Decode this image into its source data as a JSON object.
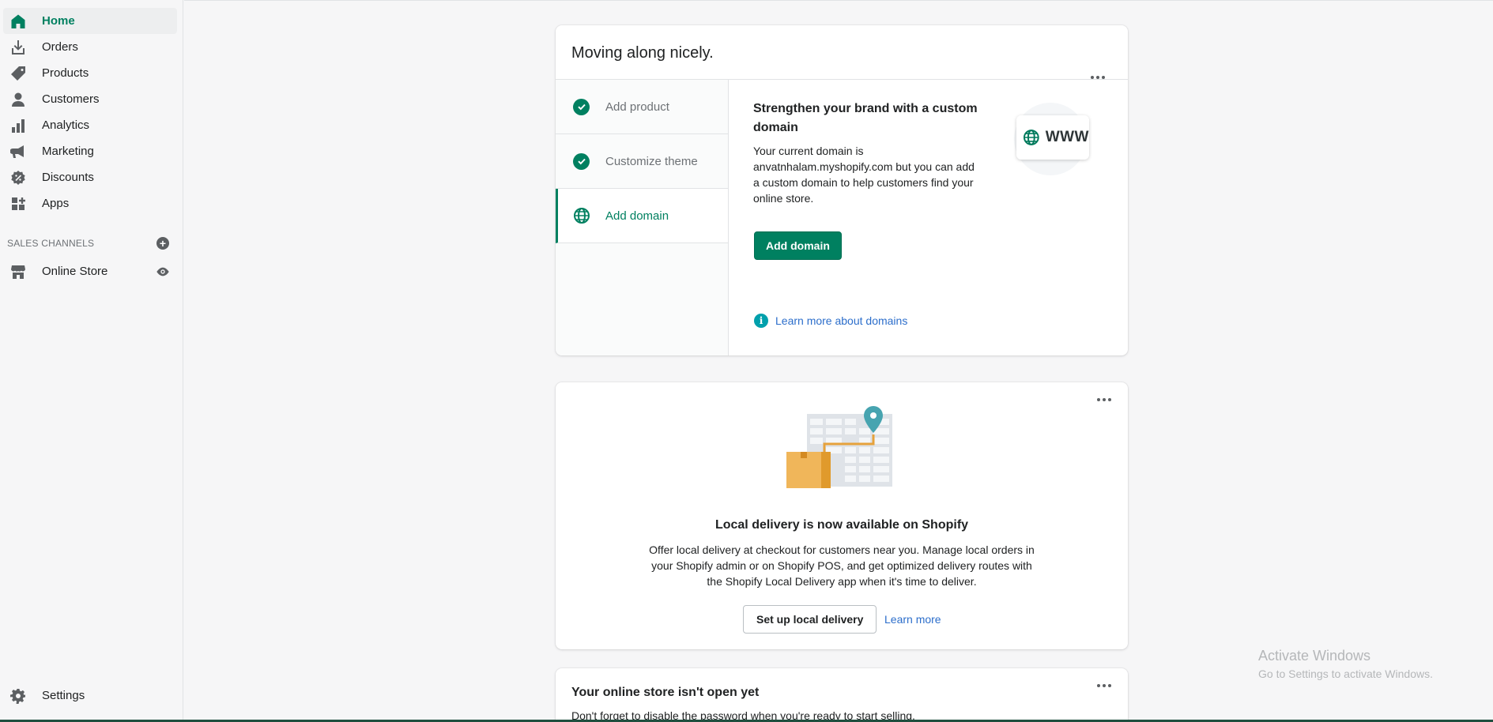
{
  "sidebar": {
    "items": [
      {
        "label": "Home",
        "icon": "home-icon"
      },
      {
        "label": "Orders",
        "icon": "orders-icon"
      },
      {
        "label": "Products",
        "icon": "tag-icon"
      },
      {
        "label": "Customers",
        "icon": "person-icon"
      },
      {
        "label": "Analytics",
        "icon": "bar-chart-icon"
      },
      {
        "label": "Marketing",
        "icon": "megaphone-icon"
      },
      {
        "label": "Discounts",
        "icon": "discount-icon"
      },
      {
        "label": "Apps",
        "icon": "apps-icon"
      }
    ],
    "sales_channels_label": "SALES CHANNELS",
    "online_store_label": "Online Store",
    "settings_label": "Settings"
  },
  "setup_card": {
    "title": "Moving along nicely.",
    "steps": [
      {
        "label": "Add product",
        "status": "complete"
      },
      {
        "label": "Customize theme",
        "status": "complete"
      },
      {
        "label": "Add domain",
        "status": "active"
      }
    ],
    "content_title": "Strengthen your brand with a custom domain",
    "content_body": "Your current domain is anvatnhalam.myshopify.com but you can add a custom domain to help customers find your online store.",
    "button_label": "Add domain",
    "learn_link": "Learn more about domains",
    "badge_text": "WWW"
  },
  "delivery_card": {
    "title": "Local delivery is now available on Shopify",
    "body": "Offer local delivery at checkout for customers near you. Manage local orders in your Shopify admin or on Shopify POS, and get optimized delivery routes with the Shopify Local Delivery app when it's time to deliver.",
    "button_label": "Set up local delivery",
    "learn_link": "Learn more"
  },
  "store_card": {
    "title": "Your online store isn't open yet",
    "body": "Don't forget to disable the password when you're ready to start selling."
  },
  "watermark": {
    "line1": "Activate Windows",
    "line2": "Go to Settings to activate Windows."
  },
  "colors": {
    "accent": "#008060",
    "link": "#2c6ecb"
  }
}
